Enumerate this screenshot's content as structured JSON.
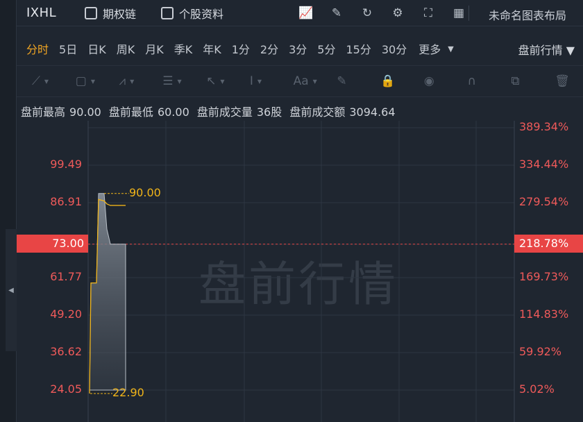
{
  "header": {
    "ticker": "IXHL",
    "options_chain_label": "期权链",
    "stock_info_label": "个股资料",
    "layout_name": "未命名图表布局"
  },
  "periods": [
    "分时",
    "5日",
    "日K",
    "周K",
    "月K",
    "季K",
    "年K",
    "1分",
    "2分",
    "3分",
    "5分",
    "15分",
    "30分"
  ],
  "active_period": "分时",
  "more_label": "更多",
  "session_label": "盘前行情",
  "stats": {
    "high_label": "盘前最高",
    "high_value": "90.00",
    "low_label": "盘前最低",
    "low_value": "60.00",
    "volume_label": "盘前成交量",
    "volume_value": "36股",
    "turnover_label": "盘前成交额",
    "turnover_value": "3094.64"
  },
  "watermark": "盘前行情",
  "colors": {
    "accent": "#f2a623",
    "down": "#e84545",
    "line": "#f0b419",
    "bg": "#1f2630"
  },
  "chart_data": {
    "type": "line",
    "title": "",
    "y_left_labels": [
      "99.49",
      "86.91",
      "73.00",
      "61.77",
      "49.20",
      "36.62",
      "24.05"
    ],
    "y_right_labels": [
      "389.34%",
      "334.44%",
      "279.54%",
      "218.78%",
      "169.73%",
      "114.83%",
      "59.92%",
      "5.02%"
    ],
    "prev_close": 73.0,
    "prev_close_label": "73.00",
    "prev_close_pct_label": "218.78%",
    "high_label": "90.00",
    "low_label": "22.90",
    "ylim": [
      24.05,
      99.49
    ],
    "series": [
      {
        "values": [
          22.9,
          60.0,
          60.0,
          88.0,
          87.5,
          86.5,
          86.0,
          86.0,
          86.0
        ]
      }
    ],
    "area_values": [
      22.9,
      60.0,
      60.0,
      90.0,
      90.0,
      78.0,
      73.0,
      73.0,
      73.0
    ]
  }
}
